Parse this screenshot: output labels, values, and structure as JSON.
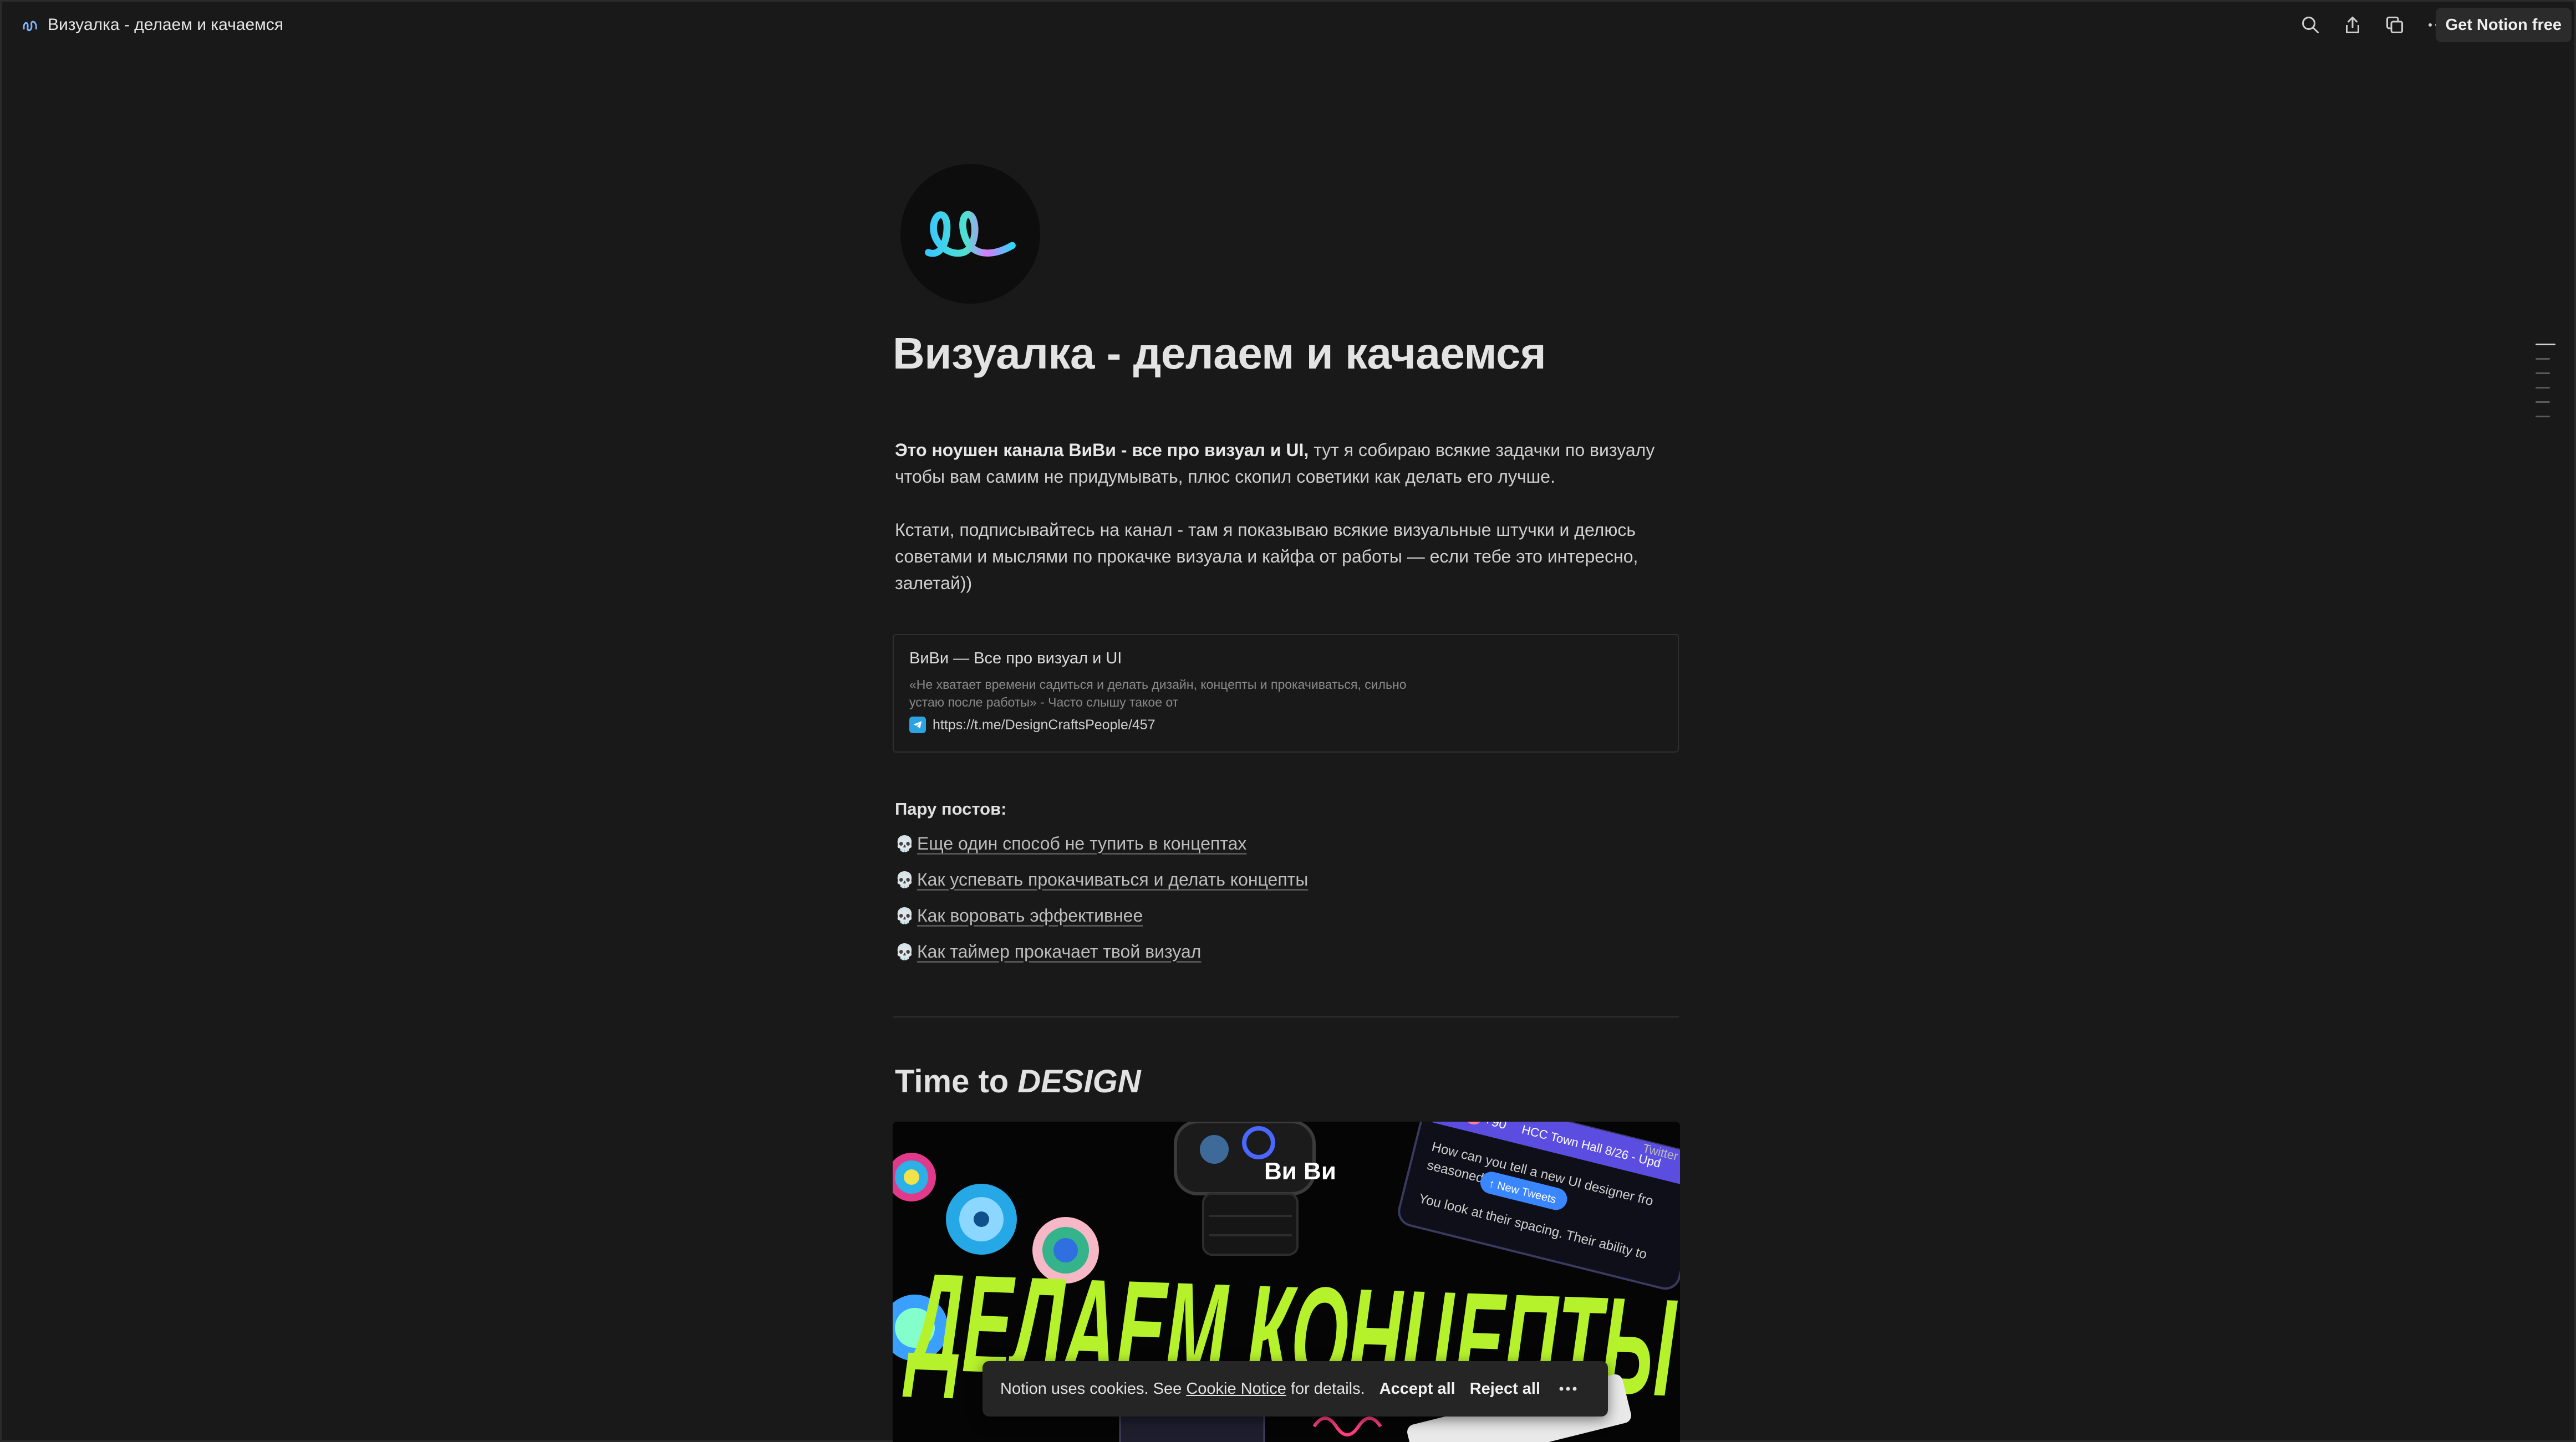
{
  "topbar": {
    "title": "Визуалка - делаем и качаемся",
    "icons": [
      "search-icon",
      "share-icon",
      "duplicate-icon",
      "more-icon"
    ],
    "cta_label": "Get Notion free"
  },
  "page": {
    "title": "Визуалка - делаем и качаемся",
    "intro_bold": "Это ноушен канала ВиВи - все про визуал и UI,",
    "intro_rest": " тут я собираю всякие задачки по визуалу чтобы вам самим не придумывать, плюс скопил советики как делать его лучше.",
    "subscribe_text": "Кстати, подписывайтесь на канал - там я показываю всякие визуальные штучки и делюсь советами и мыслями по прокачке визуала и кайфа от работы — если тебе это интересно, залетай))"
  },
  "bookmark": {
    "title": "ВиВи — Все про визуал и UI",
    "description": "«Не хватает времени садиться и делать дизайн, концепты и прокачиваться, сильно устаю после работы» - Часто слышу такое от",
    "url": "https://t.me/DesignCraftsPeople/457"
  },
  "posts": {
    "heading": "Пару постов:",
    "items": [
      {
        "icon": "skull-icon",
        "emoji": "💀",
        "label": "Еще один способ не тупить в концептах"
      },
      {
        "icon": "skull-icon",
        "emoji": "💀",
        "label": "Как успевать прокачиваться и делать концепты"
      },
      {
        "icon": "skull-icon",
        "emoji": "💀",
        "label": "Как воровать эффективнее"
      },
      {
        "icon": "skull-icon",
        "emoji": "💀",
        "label": "Как таймер прокачает твой визуал"
      }
    ]
  },
  "section": {
    "heading_plain": "Time to ",
    "heading_italic": "DESIGN"
  },
  "cover": {
    "headline": "ДЕЛАЕМ КОНЦЕПТЫ",
    "logo_text": "Ви Ви",
    "tweet_badge": "+90",
    "tweet_header": "HCC Town Hall 8/26 - Upd",
    "tweet_line1": "How can you tell a new UI designer fro",
    "tweet_line2": "seasoned",
    "tweet_line3": "You look at their spacing. Their ability to",
    "new_tweets": "↑ New Tweets",
    "corner_label": "Twitter"
  },
  "cookie": {
    "text_before": "Notion uses cookies. See ",
    "notice_link": "Cookie Notice",
    "text_after": " for details.",
    "accept": "Accept all",
    "reject": "Reject all"
  },
  "colors": {
    "background": "#191919",
    "text": "#d4d4d4",
    "cover_green": "#b6f22c",
    "telegram_blue": "#2aa3e0"
  }
}
